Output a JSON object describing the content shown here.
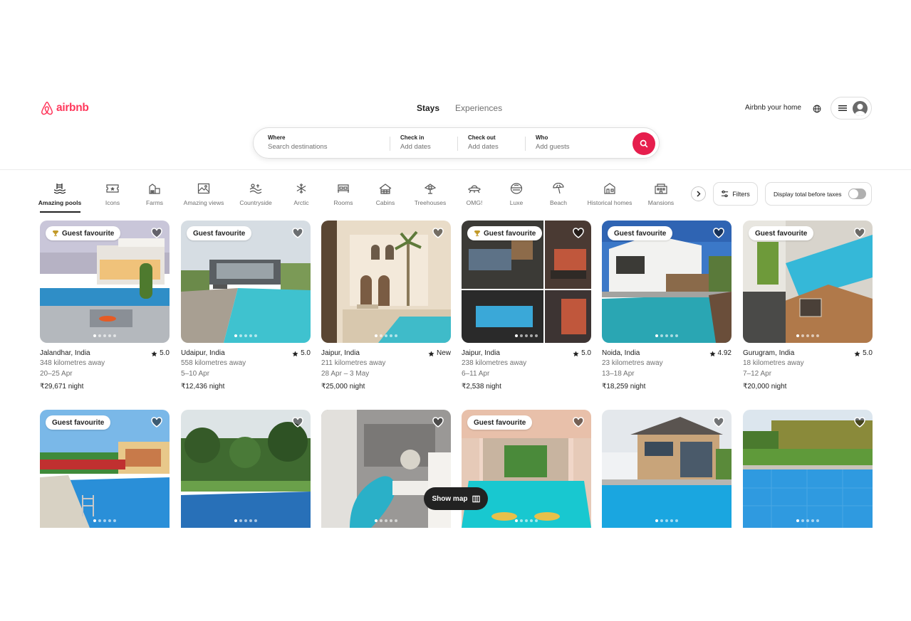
{
  "header": {
    "logo_text": "airbnb",
    "tabs": [
      {
        "label": "Stays",
        "active": true
      },
      {
        "label": "Experiences",
        "active": false
      }
    ],
    "host_link": "Airbnb your home",
    "globe_icon": "globe-icon",
    "menu_icon": "hamburger-menu-icon",
    "avatar_icon": "user-avatar-icon"
  },
  "search": {
    "where": {
      "label": "Where",
      "placeholder": "Search destinations"
    },
    "checkin": {
      "label": "Check in",
      "placeholder": "Add dates"
    },
    "checkout": {
      "label": "Check out",
      "placeholder": "Add dates"
    },
    "who": {
      "label": "Who",
      "placeholder": "Add guests"
    },
    "button_icon": "search-icon"
  },
  "categories": [
    {
      "label": "Amazing pools",
      "icon": "pool-icon",
      "active": true
    },
    {
      "label": "Icons",
      "icon": "ticket-icon",
      "active": false
    },
    {
      "label": "Farms",
      "icon": "barn-icon",
      "active": false
    },
    {
      "label": "Amazing views",
      "icon": "landscape-icon",
      "active": false
    },
    {
      "label": "Countryside",
      "icon": "countryside-icon",
      "active": false
    },
    {
      "label": "Arctic",
      "icon": "snowflake-icon",
      "active": false
    },
    {
      "label": "Rooms",
      "icon": "bed-icon",
      "active": false
    },
    {
      "label": "Cabins",
      "icon": "cabin-icon",
      "active": false
    },
    {
      "label": "Treehouses",
      "icon": "treehouse-icon",
      "active": false
    },
    {
      "label": "OMG!",
      "icon": "ufo-house-icon",
      "active": false
    },
    {
      "label": "Luxe",
      "icon": "diamond-icon",
      "active": false
    },
    {
      "label": "Beach",
      "icon": "umbrella-icon",
      "active": false
    },
    {
      "label": "Historical homes",
      "icon": "historic-house-icon",
      "active": false
    },
    {
      "label": "Mansions",
      "icon": "mansion-icon",
      "active": false
    }
  ],
  "filters": {
    "label": "Filters",
    "icon": "sliders-icon"
  },
  "taxes_toggle": {
    "label": "Display total before taxes",
    "on": false
  },
  "listings": [
    {
      "badge": "Guest favourite",
      "trophy": true,
      "location": "Jalandhar, India",
      "rating": "5.0",
      "distance": "348 kilometres away",
      "dates": "20–25 Apr",
      "price": "₹29,671",
      "price_unit": "night"
    },
    {
      "badge": "Guest favourite",
      "trophy": false,
      "location": "Udaipur, India",
      "rating": "5.0",
      "distance": "558 kilometres away",
      "dates": "5–10 Apr",
      "price": "₹12,436",
      "price_unit": "night"
    },
    {
      "badge": "",
      "trophy": false,
      "location": "Jaipur, India",
      "rating": "New",
      "distance": "211 kilometres away",
      "dates": "28 Apr – 3 May",
      "price": "₹25,000",
      "price_unit": "night"
    },
    {
      "badge": "Guest favourite",
      "trophy": true,
      "location": "Jaipur, India",
      "rating": "5.0",
      "distance": "238 kilometres away",
      "dates": "6–11 Apr",
      "price": "₹2,538",
      "price_unit": "night"
    },
    {
      "badge": "Guest favourite",
      "trophy": false,
      "location": "Noida, India",
      "rating": "4.92",
      "distance": "23 kilometres away",
      "dates": "13–18 Apr",
      "price": "₹18,259",
      "price_unit": "night"
    },
    {
      "badge": "Guest favourite",
      "trophy": false,
      "location": "Gurugram, India",
      "rating": "5.0",
      "distance": "18 kilometres away",
      "dates": "7–12 Apr",
      "price": "₹20,000",
      "price_unit": "night"
    }
  ],
  "listings_row2": [
    {
      "badge": "Guest favourite"
    },
    {
      "badge": ""
    },
    {
      "badge": ""
    },
    {
      "badge": "Guest favourite"
    },
    {
      "badge": ""
    },
    {
      "badge": ""
    }
  ],
  "show_map": {
    "label": "Show map",
    "icon": "map-icon"
  },
  "colors": {
    "brand": "#ff385c",
    "search_button": "#e61e4d",
    "text": "#222222",
    "muted": "#717171"
  }
}
